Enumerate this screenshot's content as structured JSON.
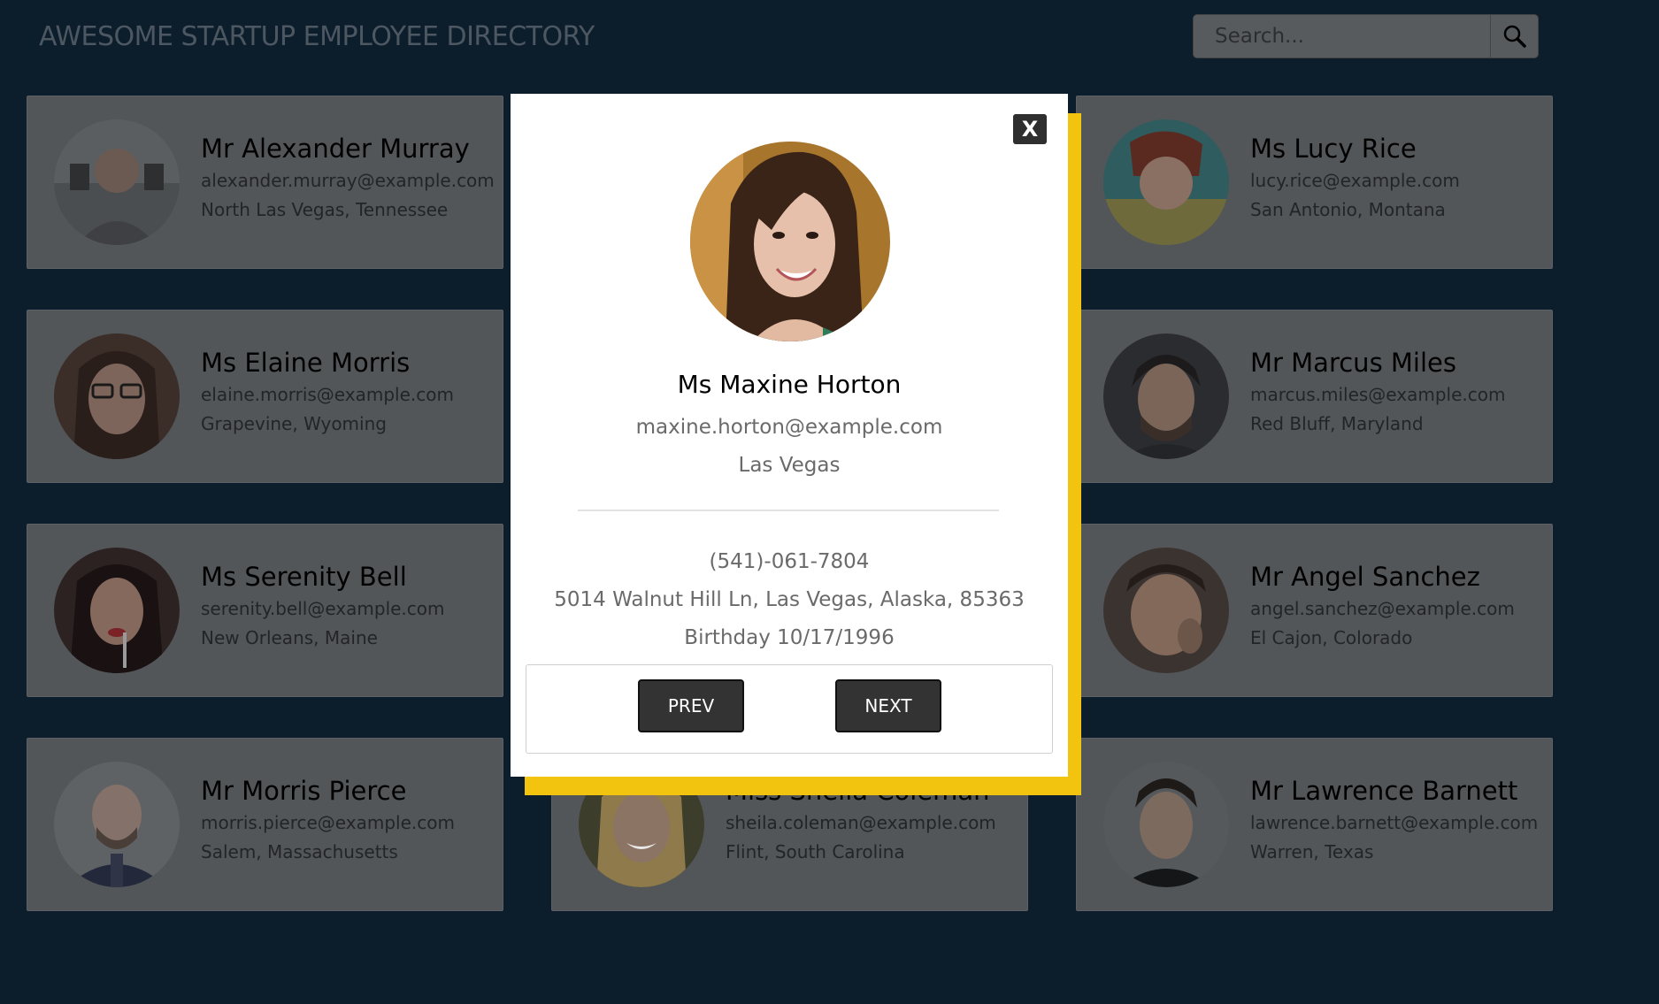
{
  "header": {
    "title": "AWESOME STARTUP EMPLOYEE DIRECTORY"
  },
  "search": {
    "placeholder": "Search...",
    "button_icon": "search-icon"
  },
  "employees": [
    {
      "name": "Mr Alexander Murray",
      "email": "alexander.murray@example.com",
      "location": "North Las Vegas, Tennessee"
    },
    {
      "name": "",
      "email": "",
      "location": ""
    },
    {
      "name": "Ms Lucy Rice",
      "email": "lucy.rice@example.com",
      "location": "San Antonio, Montana"
    },
    {
      "name": "Ms Elaine Morris",
      "email": "elaine.morris@example.com",
      "location": "Grapevine, Wyoming"
    },
    {
      "name": "",
      "email": "",
      "location": ""
    },
    {
      "name": "Mr Marcus Miles",
      "email": "marcus.miles@example.com",
      "location": "Red Bluff, Maryland"
    },
    {
      "name": "Ms Serenity Bell",
      "email": "serenity.bell@example.com",
      "location": "New Orleans, Maine"
    },
    {
      "name": "",
      "email": "",
      "location": ""
    },
    {
      "name": "Mr Angel Sanchez",
      "email": "angel.sanchez@example.com",
      "location": "El Cajon, Colorado"
    },
    {
      "name": "Mr Morris Pierce",
      "email": "morris.pierce@example.com",
      "location": "Salem, Massachusetts"
    },
    {
      "name": "Miss Sheila Coleman",
      "email": "sheila.coleman@example.com",
      "location": "Flint, South Carolina"
    },
    {
      "name": "Mr Lawrence Barnett",
      "email": "lawrence.barnett@example.com",
      "location": "Warren, Texas"
    }
  ],
  "modal": {
    "close_label": "X",
    "name": "Ms Maxine Horton",
    "email": "maxine.horton@example.com",
    "city": "Las Vegas",
    "phone": "(541)-061-7804",
    "address": "5014 Walnut Hill Ln, Las Vegas, Alaska, 85363",
    "birthday": "Birthday 10/17/1996",
    "prev_label": "PREV",
    "next_label": "NEXT"
  },
  "colors": {
    "page_background": "#0c1d2c",
    "card_background": "#535659",
    "modal_background": "#ffffff",
    "modal_accent": "#f2c40f",
    "button_background": "#333333"
  }
}
